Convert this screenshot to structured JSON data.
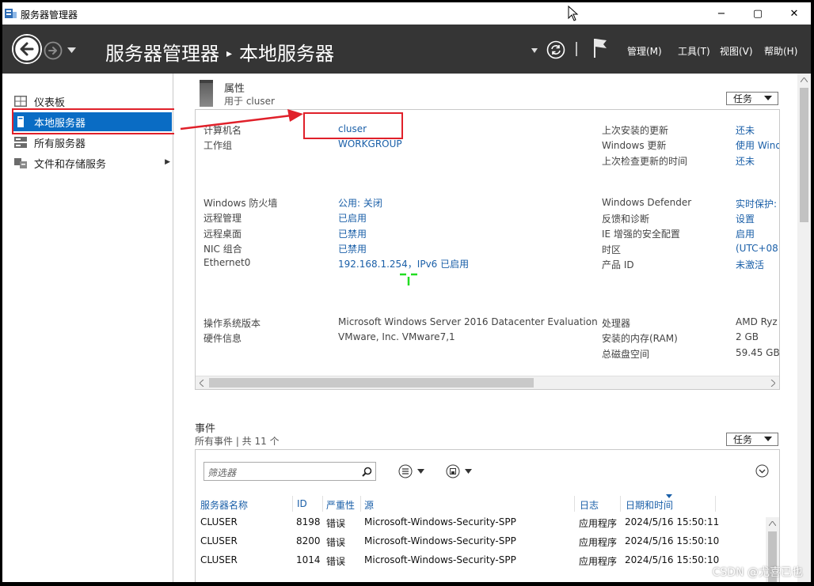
{
  "window": {
    "title": "服务器管理器",
    "controls": {
      "minimize": "−",
      "maximize": "▢",
      "close": "✕"
    }
  },
  "header": {
    "title": "服务器管理器",
    "separator": "▸",
    "page": "本地服务器",
    "menus": [
      "管理(M)",
      "工具(T)",
      "视图(V)",
      "帮助(H)"
    ]
  },
  "sidebar": {
    "items": [
      {
        "label": "仪表板",
        "icon": "dashboard-icon"
      },
      {
        "label": "本地服务器",
        "icon": "server-icon",
        "selected": true
      },
      {
        "label": "所有服务器",
        "icon": "servers-icon"
      },
      {
        "label": "文件和存储服务",
        "icon": "storage-icon",
        "expand": "▶"
      }
    ]
  },
  "properties": {
    "title": "属性",
    "subtitle": "用于 cluser",
    "tasks_label": "任务",
    "left": [
      {
        "label": "计算机名",
        "value": "cluser"
      },
      {
        "label": "工作组",
        "value": "WORKGROUP"
      },
      {
        "label": "Windows 防火墙",
        "value": "公用: 关闭"
      },
      {
        "label": "远程管理",
        "value": "已启用"
      },
      {
        "label": "远程桌面",
        "value": "已禁用"
      },
      {
        "label": "NIC 组合",
        "value": "已禁用"
      },
      {
        "label": "Ethernet0",
        "value": "192.168.1.254，IPv6 已启用"
      },
      {
        "label": "操作系统版本",
        "value": "Microsoft Windows Server 2016 Datacenter Evaluation"
      },
      {
        "label": "硬件信息",
        "value": "VMware, Inc. VMware7,1"
      }
    ],
    "right": [
      {
        "label": "上次安装的更新",
        "value": "还未"
      },
      {
        "label": "Windows 更新",
        "value": "使用 Wind"
      },
      {
        "label": "上次检查更新的时间",
        "value": "还未"
      },
      {
        "label": "Windows Defender",
        "value": "实时保护:"
      },
      {
        "label": "反馈和诊断",
        "value": "设置"
      },
      {
        "label": "IE 增强的安全配置",
        "value": "启用"
      },
      {
        "label": "时区",
        "value": "(UTC+08:"
      },
      {
        "label": "产品 ID",
        "value": "未激活"
      },
      {
        "label": "处理器",
        "value": "AMD Ryz"
      },
      {
        "label": "安装的内存(RAM)",
        "value": "2 GB"
      },
      {
        "label": "总磁盘空间",
        "value": "59.45 GB"
      }
    ]
  },
  "events": {
    "title": "事件",
    "subtitle": "所有事件 | 共 11 个",
    "tasks_label": "任务",
    "filter_placeholder": "筛选器",
    "columns": [
      "服务器名称",
      "ID",
      "严重性",
      "源",
      "日志",
      "日期和时间"
    ],
    "rows": [
      {
        "server": "CLUSER",
        "id": "8198",
        "severity": "错误",
        "source": "Microsoft-Windows-Security-SPP",
        "log": "应用程序",
        "datetime": "2024/5/16 15:50:11"
      },
      {
        "server": "CLUSER",
        "id": "8200",
        "severity": "错误",
        "source": "Microsoft-Windows-Security-SPP",
        "log": "应用程序",
        "datetime": "2024/5/16 15:50:10"
      },
      {
        "server": "CLUSER",
        "id": "1014",
        "severity": "错误",
        "source": "Microsoft-Windows-Security-SPP",
        "log": "应用程序",
        "datetime": "2024/5/16 15:50:10"
      }
    ]
  },
  "watermark": "CSDN @尤喜已也",
  "colors": {
    "header_bg": "#353535",
    "accent": "#0a6cc4",
    "link": "#1a5fa8",
    "annotation": "#e0202a"
  }
}
